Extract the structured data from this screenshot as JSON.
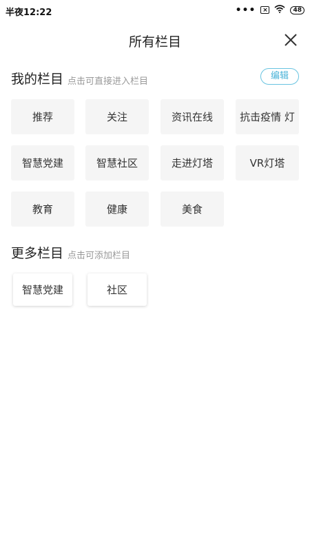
{
  "status": {
    "time": "半夜12:22",
    "battery": "48",
    "sim": "×"
  },
  "header": {
    "title": "所有栏目"
  },
  "my_columns": {
    "title": "我的栏目",
    "hint": "点击可直接进入栏目",
    "edit_label": "编辑",
    "items": [
      {
        "label": "推荐"
      },
      {
        "label": "关注"
      },
      {
        "label": "资讯在线"
      },
      {
        "label": "抗击疫情 灯"
      },
      {
        "label": "智慧党建"
      },
      {
        "label": "智慧社区"
      },
      {
        "label": "走进灯塔"
      },
      {
        "label": "VR灯塔"
      },
      {
        "label": "教育"
      },
      {
        "label": "健康"
      },
      {
        "label": "美食"
      }
    ]
  },
  "more_columns": {
    "title": "更多栏目",
    "hint": "点击可添加栏目",
    "items": [
      {
        "label": "智慧党建"
      },
      {
        "label": "社区"
      }
    ]
  },
  "colors": {
    "accent": "#4ab3d8",
    "tile_bg": "#f5f5f5",
    "hint": "#999999"
  }
}
